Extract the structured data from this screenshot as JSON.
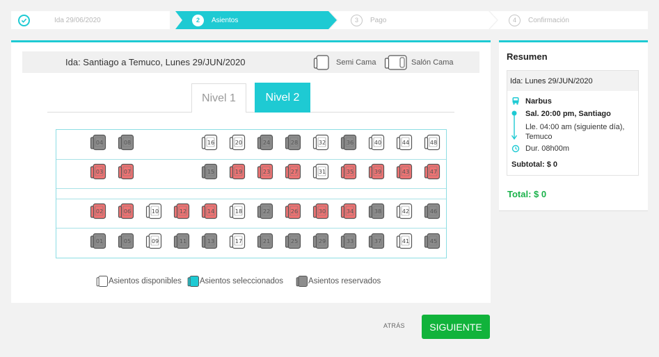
{
  "steps": [
    {
      "label": "Ida 29/06/2020",
      "num": "",
      "state": "done"
    },
    {
      "label": "Asientos",
      "num": "2",
      "state": "active"
    },
    {
      "label": "Pago",
      "num": "3",
      "state": "pending"
    },
    {
      "label": "Confirmación",
      "num": "4",
      "state": "pending"
    }
  ],
  "trip": {
    "title": "Ida: Santiago a Temuco, Lunes 29/JUN/2020",
    "semi_cama": "Semi Cama",
    "salon_cama": "Salón Cama"
  },
  "tabs": {
    "level1": "Nivel 1",
    "level2": "Nivel 2",
    "active": "level2"
  },
  "seat_rows": [
    [
      {
        "n": "04",
        "s": "reserved"
      },
      {
        "n": "08",
        "s": "reserved"
      },
      {
        "n": "16",
        "s": "available"
      },
      {
        "n": "20",
        "s": "available"
      },
      {
        "n": "24",
        "s": "reserved"
      },
      {
        "n": "28",
        "s": "reserved"
      },
      {
        "n": "32",
        "s": "available"
      },
      {
        "n": "36",
        "s": "reserved"
      },
      {
        "n": "40",
        "s": "available"
      },
      {
        "n": "44",
        "s": "available"
      },
      {
        "n": "48",
        "s": "available"
      }
    ],
    [
      {
        "n": "03",
        "s": "red"
      },
      {
        "n": "07",
        "s": "red"
      },
      {
        "n": "15",
        "s": "reserved"
      },
      {
        "n": "19",
        "s": "red"
      },
      {
        "n": "23",
        "s": "red"
      },
      {
        "n": "27",
        "s": "red"
      },
      {
        "n": "31",
        "s": "available"
      },
      {
        "n": "35",
        "s": "red"
      },
      {
        "n": "39",
        "s": "red"
      },
      {
        "n": "43",
        "s": "red"
      },
      {
        "n": "47",
        "s": "red"
      }
    ],
    [
      {
        "n": "02",
        "s": "red"
      },
      {
        "n": "06",
        "s": "red"
      },
      {
        "n": "10",
        "s": "available"
      },
      {
        "n": "12",
        "s": "red"
      },
      {
        "n": "14",
        "s": "red"
      },
      {
        "n": "18",
        "s": "available"
      },
      {
        "n": "22",
        "s": "reserved"
      },
      {
        "n": "26",
        "s": "red"
      },
      {
        "n": "30",
        "s": "red"
      },
      {
        "n": "34",
        "s": "red"
      },
      {
        "n": "38",
        "s": "reserved"
      },
      {
        "n": "42",
        "s": "available"
      },
      {
        "n": "46",
        "s": "reserved"
      }
    ],
    [
      {
        "n": "01",
        "s": "reserved"
      },
      {
        "n": "05",
        "s": "reserved"
      },
      {
        "n": "09",
        "s": "available"
      },
      {
        "n": "11",
        "s": "reserved"
      },
      {
        "n": "13",
        "s": "reserved"
      },
      {
        "n": "17",
        "s": "available"
      },
      {
        "n": "21",
        "s": "reserved"
      },
      {
        "n": "25",
        "s": "reserved"
      },
      {
        "n": "29",
        "s": "reserved"
      },
      {
        "n": "33",
        "s": "reserved"
      },
      {
        "n": "37",
        "s": "reserved"
      },
      {
        "n": "41",
        "s": "available"
      },
      {
        "n": "45",
        "s": "reserved"
      }
    ]
  ],
  "legend": {
    "available": "Asientos disponibles",
    "selected": "Asientos seleccionados",
    "reserved": "Asientos reservados"
  },
  "summary": {
    "title": "Resumen",
    "date": "Ida: Lunes 29/JUN/2020",
    "company": "Narbus",
    "departure": "Sal. 20:00 pm, Santiago",
    "arrival_1": "Lle. 04:00 am (siguiente día),",
    "arrival_2": "Temuco",
    "duration": "Dur.  08h00m",
    "subtotal": "Subtotal: $ 0",
    "total": "Total: $ 0"
  },
  "actions": {
    "back": "ATRÁS",
    "next": "SIGUIENTE"
  },
  "colors": {
    "accent": "#1ecad3",
    "reserved": "#8d8d8d",
    "red": "#ef7373",
    "green": "#11b33b"
  }
}
